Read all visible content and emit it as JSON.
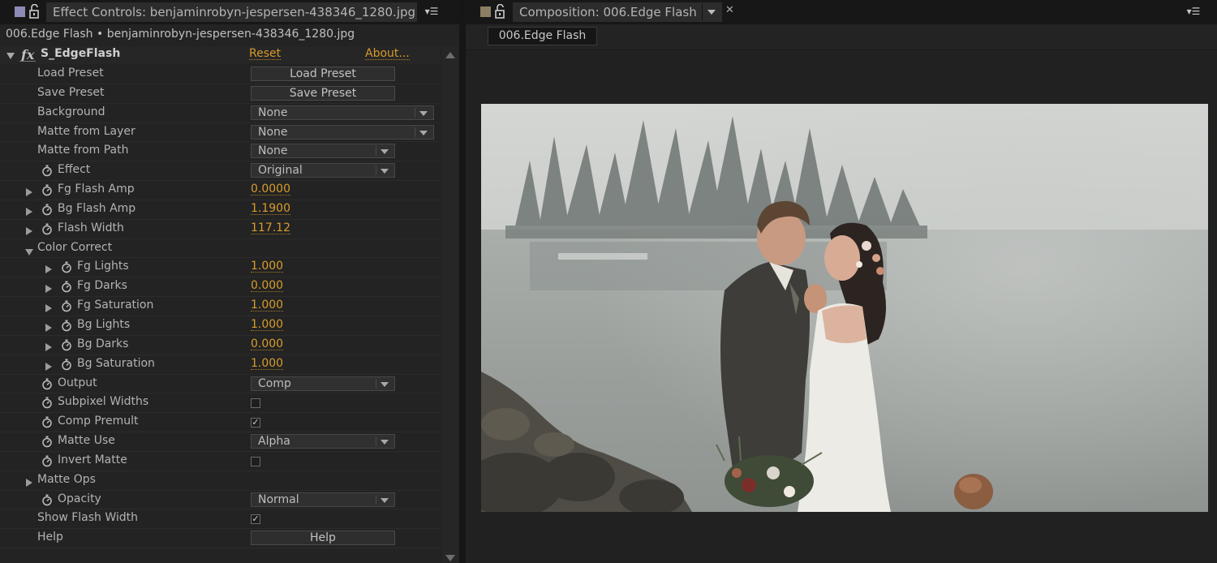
{
  "effect_controls": {
    "tab_title": "Effect Controls: benjaminrobyn-jespersen-438346_1280.jpg",
    "breadcrumb": "006.Edge Flash • benjaminrobyn-jespersen-438346_1280.jpg",
    "effect_name": "S_EdgeFlash",
    "fx_badge": "fx",
    "reset_label": "Reset",
    "about_label": "About...",
    "properties": [
      {
        "label": "Load Preset",
        "control": "button",
        "text": "Load Preset"
      },
      {
        "label": "Save Preset",
        "control": "button",
        "text": "Save Preset"
      },
      {
        "label": "Background",
        "control": "dropdown",
        "text": "None"
      },
      {
        "label": "Matte from Layer",
        "control": "dropdown",
        "text": "None"
      },
      {
        "label": "Matte from Path",
        "control": "dropdown",
        "text": "None"
      },
      {
        "label": "Effect",
        "control": "dropdown",
        "text": "Original"
      },
      {
        "label": "Fg Flash Amp",
        "control": "value",
        "text": "0.0000"
      },
      {
        "label": "Bg Flash Amp",
        "control": "value",
        "text": "1.1900"
      },
      {
        "label": "Flash Width",
        "control": "value",
        "text": "117.12"
      },
      {
        "label": "Color Correct",
        "control": "group"
      },
      {
        "label": "Fg Lights",
        "control": "value",
        "text": "1.000"
      },
      {
        "label": "Fg Darks",
        "control": "value",
        "text": "0.000"
      },
      {
        "label": "Fg Saturation",
        "control": "value",
        "text": "1.000"
      },
      {
        "label": "Bg Lights",
        "control": "value",
        "text": "1.000"
      },
      {
        "label": "Bg Darks",
        "control": "value",
        "text": "0.000"
      },
      {
        "label": "Bg Saturation",
        "control": "value",
        "text": "1.000"
      },
      {
        "label": "Output",
        "control": "dropdown",
        "text": "Comp"
      },
      {
        "label": "Subpixel Widths",
        "control": "checkbox",
        "checked": false
      },
      {
        "label": "Comp Premult",
        "control": "checkbox",
        "checked": true
      },
      {
        "label": "Matte Use",
        "control": "dropdown",
        "text": "Alpha"
      },
      {
        "label": "Invert Matte",
        "control": "checkbox",
        "checked": false
      },
      {
        "label": "Matte Ops",
        "control": "group"
      },
      {
        "label": "Opacity",
        "control": "dropdown",
        "text": "Normal"
      },
      {
        "label": "Show Flash Width",
        "control": "checkbox",
        "checked": true
      },
      {
        "label": "Help",
        "control": "button",
        "text": "Help"
      }
    ]
  },
  "composition": {
    "tab_title": "Composition: 006.Edge Flash",
    "comp_tab": "006.Edge Flash",
    "viewer_image": "wedding-couple-kissing-lake-photo"
  },
  "icons": {
    "menu": "panel-menu-icon",
    "lock": "lock-icon",
    "stopwatch": "stopwatch-icon",
    "close": "close-icon"
  },
  "colors": {
    "accent_value": "#d79d2c",
    "panel_bg": "#232323",
    "header_bg": "#171717"
  }
}
